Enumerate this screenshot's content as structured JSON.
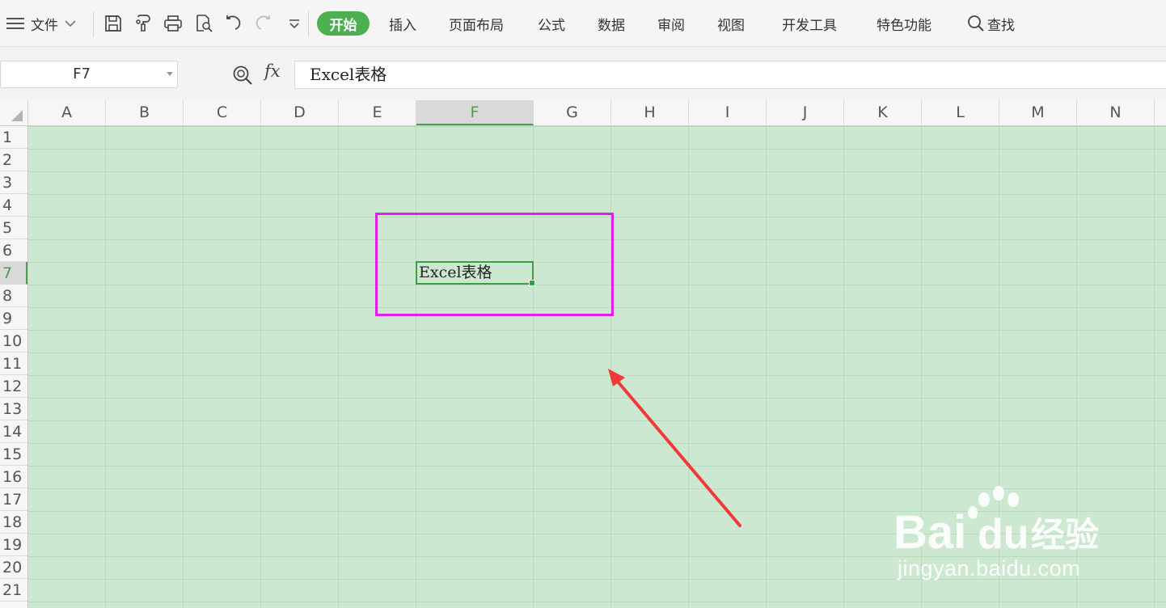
{
  "ribbon": {
    "menu_label": "文件",
    "tabs": [
      {
        "label": "开始",
        "active": true
      },
      {
        "label": "插入"
      },
      {
        "label": "页面布局"
      },
      {
        "label": "公式"
      },
      {
        "label": "数据"
      },
      {
        "label": "审阅"
      },
      {
        "label": "视图"
      },
      {
        "label": "开发工具"
      },
      {
        "label": "特色功能"
      }
    ],
    "search_label": "查找",
    "quick_icons": [
      "save-icon",
      "format-painter-icon",
      "print-icon",
      "print-preview-icon",
      "undo-icon",
      "redo-icon",
      "customize-dropdown-icon"
    ],
    "accent_color": "#4caf50"
  },
  "formula_bar": {
    "cell_reference": "F7",
    "fx_label": "fx",
    "formula_value": "Excel表格"
  },
  "sheet": {
    "columns": [
      "A",
      "B",
      "C",
      "D",
      "E",
      "F",
      "G",
      "H",
      "I",
      "J",
      "K",
      "L",
      "M",
      "N"
    ],
    "selected_column": "F",
    "rows": [
      "1",
      "2",
      "3",
      "4",
      "5",
      "6",
      "7",
      "8",
      "9",
      "10",
      "11",
      "12",
      "13",
      "14",
      "15",
      "16",
      "17",
      "18",
      "19",
      "20",
      "21"
    ],
    "selected_row": "7",
    "active_cell": {
      "ref": "F7",
      "value": "Excel表格"
    },
    "background_color": "#cde8d0"
  },
  "annotation": {
    "highlight_color": "#e21fe6",
    "arrow_color": "#f03a3a"
  },
  "watermark": {
    "brand": "Baidu经验",
    "url": "jingyan.baidu.com"
  }
}
